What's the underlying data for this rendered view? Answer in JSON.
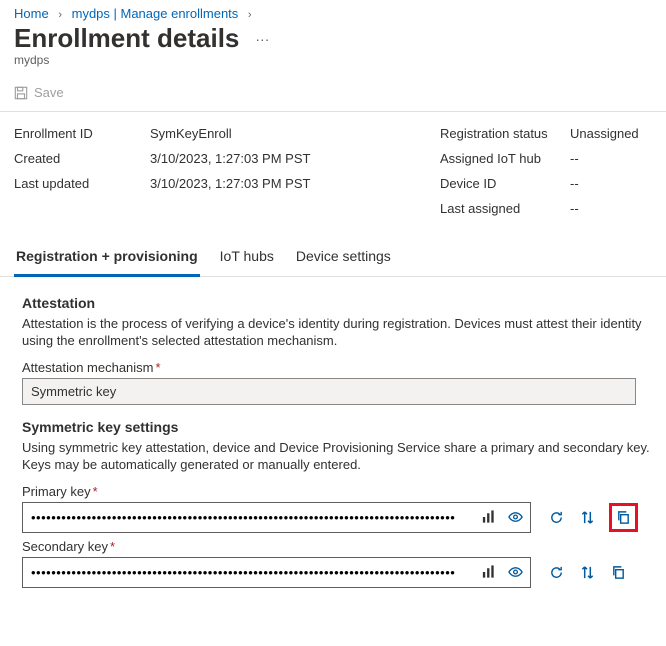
{
  "breadcrumb": {
    "home": "Home",
    "item2": "mydps | Manage enrollments"
  },
  "page": {
    "title": "Enrollment details",
    "subtitle": "mydps"
  },
  "toolbar": {
    "save_label": "Save"
  },
  "details": {
    "enrollment_id_label": "Enrollment ID",
    "enrollment_id": "SymKeyEnroll",
    "created_label": "Created",
    "created": "3/10/2023, 1:27:03 PM PST",
    "last_updated_label": "Last updated",
    "last_updated": "3/10/2023, 1:27:03 PM PST",
    "registration_status_label": "Registration status",
    "registration_status": "Unassigned",
    "assigned_hub_label": "Assigned IoT hub",
    "assigned_hub": "--",
    "device_id_label": "Device ID",
    "device_id": "--",
    "last_assigned_label": "Last assigned",
    "last_assigned": "--"
  },
  "tabs": {
    "registration": "Registration + provisioning",
    "iot_hubs": "IoT hubs",
    "device_settings": "Device settings"
  },
  "attestation": {
    "title": "Attestation",
    "desc": "Attestation is the process of verifying a device's identity during registration. Devices must attest their identity using the enrollment's selected attestation mechanism.",
    "mechanism_label": "Attestation mechanism",
    "mechanism_value": "Symmetric key",
    "sym_title": "Symmetric key settings",
    "sym_desc": "Using symmetric key attestation, device and Device Provisioning Service share a primary and secondary key. Keys may be automatically generated or manually entered.",
    "primary_label": "Primary key",
    "secondary_label": "Secondary key",
    "masked_value": "••••••••••••••••••••••••••••••••••••••••••••••••••••••••••••••••••••••••••••••••••••"
  }
}
